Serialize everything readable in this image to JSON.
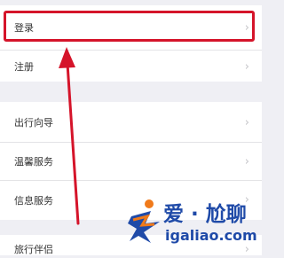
{
  "menu": {
    "group_a": [
      {
        "label": "登录"
      },
      {
        "label": "注册"
      }
    ],
    "group_b": [
      {
        "label": "出行向导"
      },
      {
        "label": "温馨服务"
      },
      {
        "label": "信息服务"
      }
    ],
    "group_c": [
      {
        "label": "旅行伴侣"
      }
    ],
    "chevron": "›"
  },
  "watermark": {
    "title": "爱 · 尬聊",
    "url": "igaliao.com"
  },
  "colors": {
    "highlight": "#d5142a",
    "watermark": "#1f4aa8",
    "watermark_accent": "#f07a1a"
  },
  "icons": [
    "chevron-right-icon",
    "annotation-arrow-icon",
    "watermark-logo-icon"
  ]
}
